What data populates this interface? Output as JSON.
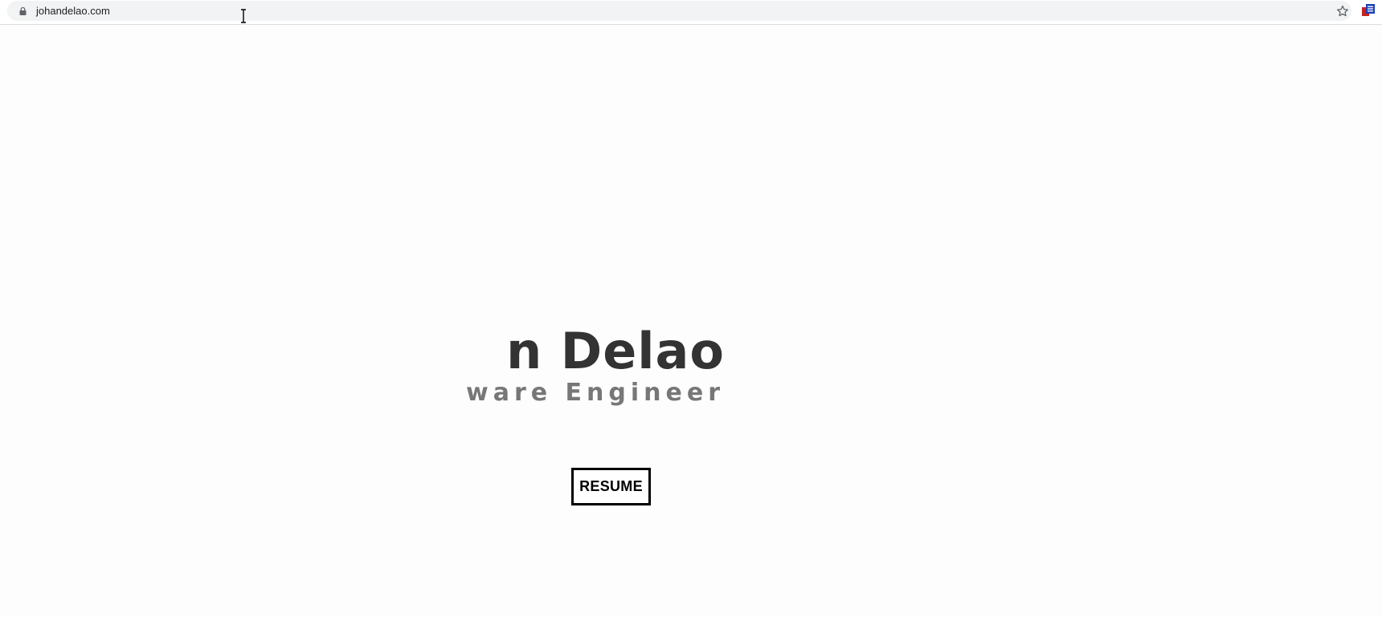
{
  "browser": {
    "url": "johandelao.com",
    "icons": {
      "lock": "lock-icon",
      "bookmark": "star-icon",
      "extension": "extension-icon"
    }
  },
  "hero": {
    "name_visible": "n Delao",
    "subtitle_visible": "ware Engineer",
    "button_label": "RESUME"
  },
  "colors": {
    "name": "#333333",
    "subtitle": "#777777",
    "button_border": "#000000",
    "background": "#fdfdfd"
  }
}
